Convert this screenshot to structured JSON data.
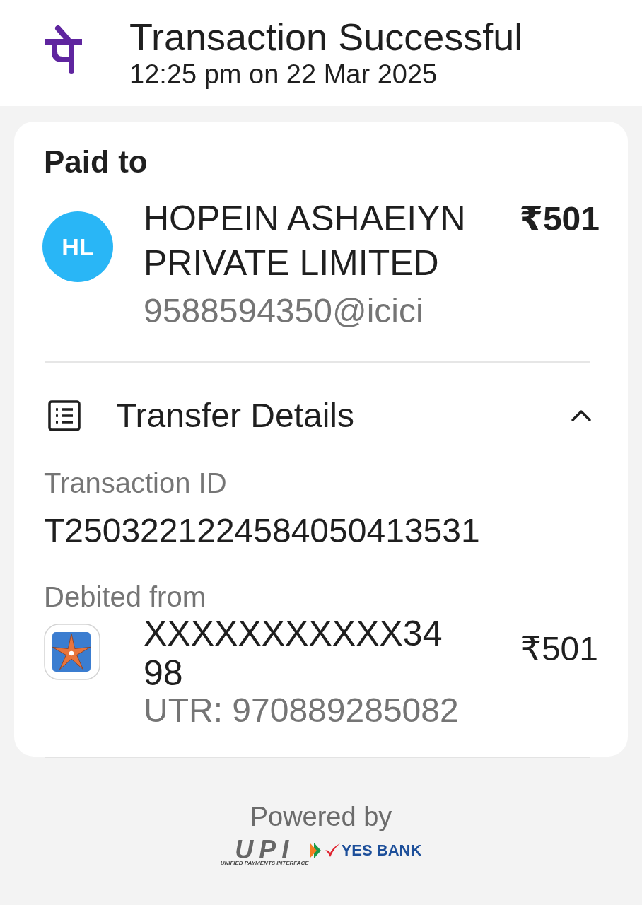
{
  "header": {
    "title": "Transaction Successful",
    "timestamp": "12:25 pm on 22 Mar 2025"
  },
  "paid_to": {
    "heading": "Paid to",
    "initials": "HL",
    "name": "HOPEIN ASHAEIYN PRIVATE LIMITED",
    "amount": "₹501",
    "upi_id": "9588594350@icici"
  },
  "transfer_details": {
    "title": "Transfer Details",
    "expanded": true,
    "fields": [
      {
        "label": "Transaction ID",
        "value": "T2503221224584050413531"
      }
    ],
    "debited_from": {
      "label": "Debited from",
      "account": "XXXXXXXXXXX3498",
      "utr": "UTR: 970889285082",
      "amount": "₹501"
    }
  },
  "footer": {
    "powered_by": "Powered by",
    "logos": [
      {
        "kind": "upi",
        "text": "UPI",
        "subtext": "UNIFIED PAYMENTS INTERFACE"
      },
      {
        "kind": "bank",
        "text": "YES BANK"
      }
    ]
  }
}
